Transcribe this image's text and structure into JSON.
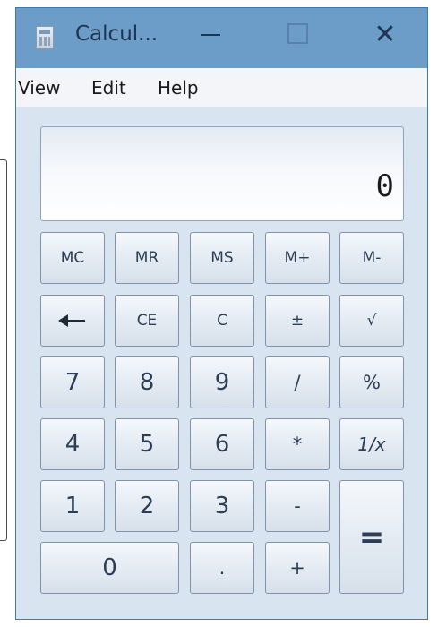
{
  "window": {
    "title": "Calcul...",
    "close_symbol": "✕"
  },
  "menu": {
    "items": [
      "View",
      "Edit",
      "Help"
    ]
  },
  "display": {
    "value": "0"
  },
  "keys": {
    "mc": "MC",
    "mr": "MR",
    "ms": "MS",
    "mplus": "M+",
    "mminus": "M-",
    "ce": "CE",
    "c": "C",
    "plusminus": "±",
    "sqrt": "√",
    "seven": "7",
    "eight": "8",
    "nine": "9",
    "divide": "/",
    "percent": "%",
    "four": "4",
    "five": "5",
    "six": "6",
    "multiply": "*",
    "reciprocal": "1/x",
    "one": "1",
    "two": "2",
    "three": "3",
    "minus": "-",
    "equals": "=",
    "zero": "0",
    "decimal": ".",
    "plus": "+"
  },
  "colors": {
    "titlebar": "#6c9cc8",
    "window_body": "#d9e4f1",
    "key_text": "#2c3e55"
  }
}
